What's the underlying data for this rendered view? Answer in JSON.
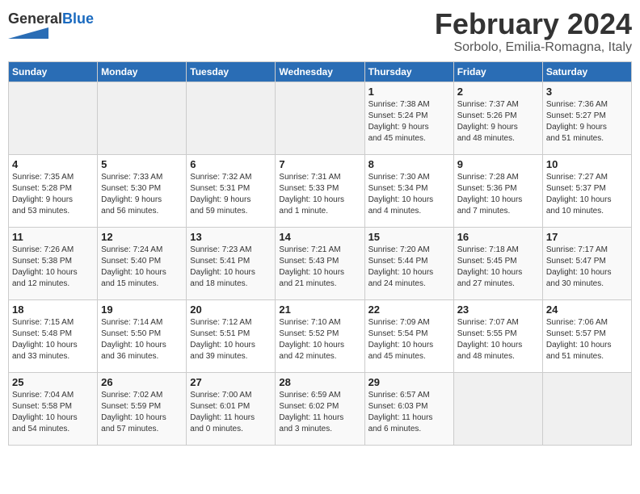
{
  "header": {
    "logo_general": "General",
    "logo_blue": "Blue",
    "month_title": "February 2024",
    "location": "Sorbolo, Emilia-Romagna, Italy"
  },
  "weekdays": [
    "Sunday",
    "Monday",
    "Tuesday",
    "Wednesday",
    "Thursday",
    "Friday",
    "Saturday"
  ],
  "weeks": [
    [
      {
        "day": "",
        "info": ""
      },
      {
        "day": "",
        "info": ""
      },
      {
        "day": "",
        "info": ""
      },
      {
        "day": "",
        "info": ""
      },
      {
        "day": "1",
        "info": "Sunrise: 7:38 AM\nSunset: 5:24 PM\nDaylight: 9 hours\nand 45 minutes."
      },
      {
        "day": "2",
        "info": "Sunrise: 7:37 AM\nSunset: 5:26 PM\nDaylight: 9 hours\nand 48 minutes."
      },
      {
        "day": "3",
        "info": "Sunrise: 7:36 AM\nSunset: 5:27 PM\nDaylight: 9 hours\nand 51 minutes."
      }
    ],
    [
      {
        "day": "4",
        "info": "Sunrise: 7:35 AM\nSunset: 5:28 PM\nDaylight: 9 hours\nand 53 minutes."
      },
      {
        "day": "5",
        "info": "Sunrise: 7:33 AM\nSunset: 5:30 PM\nDaylight: 9 hours\nand 56 minutes."
      },
      {
        "day": "6",
        "info": "Sunrise: 7:32 AM\nSunset: 5:31 PM\nDaylight: 9 hours\nand 59 minutes."
      },
      {
        "day": "7",
        "info": "Sunrise: 7:31 AM\nSunset: 5:33 PM\nDaylight: 10 hours\nand 1 minute."
      },
      {
        "day": "8",
        "info": "Sunrise: 7:30 AM\nSunset: 5:34 PM\nDaylight: 10 hours\nand 4 minutes."
      },
      {
        "day": "9",
        "info": "Sunrise: 7:28 AM\nSunset: 5:36 PM\nDaylight: 10 hours\nand 7 minutes."
      },
      {
        "day": "10",
        "info": "Sunrise: 7:27 AM\nSunset: 5:37 PM\nDaylight: 10 hours\nand 10 minutes."
      }
    ],
    [
      {
        "day": "11",
        "info": "Sunrise: 7:26 AM\nSunset: 5:38 PM\nDaylight: 10 hours\nand 12 minutes."
      },
      {
        "day": "12",
        "info": "Sunrise: 7:24 AM\nSunset: 5:40 PM\nDaylight: 10 hours\nand 15 minutes."
      },
      {
        "day": "13",
        "info": "Sunrise: 7:23 AM\nSunset: 5:41 PM\nDaylight: 10 hours\nand 18 minutes."
      },
      {
        "day": "14",
        "info": "Sunrise: 7:21 AM\nSunset: 5:43 PM\nDaylight: 10 hours\nand 21 minutes."
      },
      {
        "day": "15",
        "info": "Sunrise: 7:20 AM\nSunset: 5:44 PM\nDaylight: 10 hours\nand 24 minutes."
      },
      {
        "day": "16",
        "info": "Sunrise: 7:18 AM\nSunset: 5:45 PM\nDaylight: 10 hours\nand 27 minutes."
      },
      {
        "day": "17",
        "info": "Sunrise: 7:17 AM\nSunset: 5:47 PM\nDaylight: 10 hours\nand 30 minutes."
      }
    ],
    [
      {
        "day": "18",
        "info": "Sunrise: 7:15 AM\nSunset: 5:48 PM\nDaylight: 10 hours\nand 33 minutes."
      },
      {
        "day": "19",
        "info": "Sunrise: 7:14 AM\nSunset: 5:50 PM\nDaylight: 10 hours\nand 36 minutes."
      },
      {
        "day": "20",
        "info": "Sunrise: 7:12 AM\nSunset: 5:51 PM\nDaylight: 10 hours\nand 39 minutes."
      },
      {
        "day": "21",
        "info": "Sunrise: 7:10 AM\nSunset: 5:52 PM\nDaylight: 10 hours\nand 42 minutes."
      },
      {
        "day": "22",
        "info": "Sunrise: 7:09 AM\nSunset: 5:54 PM\nDaylight: 10 hours\nand 45 minutes."
      },
      {
        "day": "23",
        "info": "Sunrise: 7:07 AM\nSunset: 5:55 PM\nDaylight: 10 hours\nand 48 minutes."
      },
      {
        "day": "24",
        "info": "Sunrise: 7:06 AM\nSunset: 5:57 PM\nDaylight: 10 hours\nand 51 minutes."
      }
    ],
    [
      {
        "day": "25",
        "info": "Sunrise: 7:04 AM\nSunset: 5:58 PM\nDaylight: 10 hours\nand 54 minutes."
      },
      {
        "day": "26",
        "info": "Sunrise: 7:02 AM\nSunset: 5:59 PM\nDaylight: 10 hours\nand 57 minutes."
      },
      {
        "day": "27",
        "info": "Sunrise: 7:00 AM\nSunset: 6:01 PM\nDaylight: 11 hours\nand 0 minutes."
      },
      {
        "day": "28",
        "info": "Sunrise: 6:59 AM\nSunset: 6:02 PM\nDaylight: 11 hours\nand 3 minutes."
      },
      {
        "day": "29",
        "info": "Sunrise: 6:57 AM\nSunset: 6:03 PM\nDaylight: 11 hours\nand 6 minutes."
      },
      {
        "day": "",
        "info": ""
      },
      {
        "day": "",
        "info": ""
      }
    ]
  ]
}
